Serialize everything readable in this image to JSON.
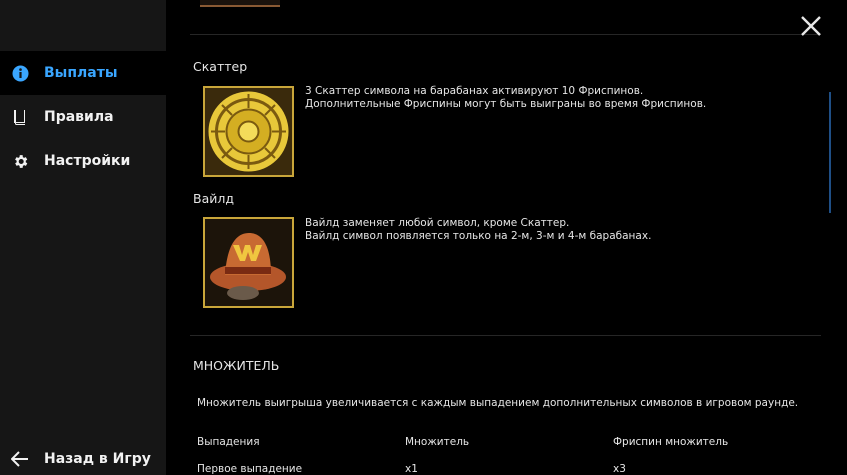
{
  "sidebar": {
    "items": [
      {
        "label": "Выплаты",
        "icon": "info-icon",
        "active": true
      },
      {
        "label": "Правила",
        "icon": "book-icon",
        "active": false
      },
      {
        "label": "Настройки",
        "icon": "gear-icon",
        "active": false
      }
    ],
    "back_label": "Назад в Игру",
    "accent_color": "#3aa6ff"
  },
  "symbols": [
    {
      "title": "Скаттер",
      "icon": "aztec-calendar-scatter-symbol",
      "lines": [
        "3 Скаттер символа на барабанах активируют 10 Фриспинов.",
        "Дополнительные Фриспины могут быть выиграны во время Фриспинов."
      ]
    },
    {
      "title": "Вайлд",
      "icon": "cowboy-hat-wild-symbol",
      "lines": [
        "Вайлд заменяет любой символ, кроме Скаттер.",
        "Вайлд символ появляется только на 2-м, 3-м и 4-м барабанах."
      ]
    }
  ],
  "multiplier": {
    "title": "МНОЖИТЕЛЬ",
    "description": "Множитель выигрыша увеличивается с каждым выпадением дополнительных символов в игровом раунде.",
    "headers": [
      "Выпадения",
      "Множитель",
      "Фриспин множитель"
    ],
    "rows": [
      [
        "Первое выпадение",
        "x1",
        "x3"
      ]
    ]
  }
}
